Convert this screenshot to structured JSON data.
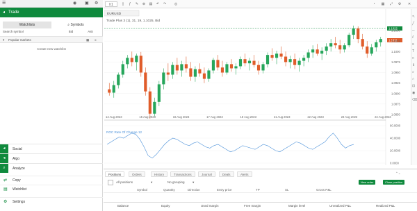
{
  "colors": {
    "brand": "#0f8a3d",
    "bull": "#26a65b",
    "bear": "#e05c2a",
    "indicator": "#4a90d9",
    "level": "#0f8a3d"
  },
  "sidebar": {
    "trade_title": "Trade",
    "tabs": [
      "Watchlists",
      "Symbols"
    ],
    "search_row": {
      "placeholder": "Search symbol",
      "bid": "Bid",
      "ask": "Ask"
    },
    "watchlist": "Popular markets",
    "create": "Create new watchlist",
    "nav": [
      {
        "label": "Social",
        "icon": "users-icon"
      },
      {
        "label": "Algo",
        "icon": "algo-icon"
      },
      {
        "label": "Analyze",
        "icon": "analyze-icon"
      }
    ],
    "nav2": [
      {
        "label": "Copy",
        "icon": "copy-icon"
      },
      {
        "label": "Watchlist",
        "icon": "list-icon"
      },
      {
        "label": "Settings",
        "icon": "gear-icon"
      }
    ]
  },
  "toolbar": {
    "timeframe": "h1",
    "symbol": "EURUSD"
  },
  "chart": {
    "legend": "Trade Plus 3 (1), 31, 19, 1.1025, Bid",
    "price_ticks": [
      "1.1050",
      "1.1025",
      "1.1000",
      "1.0975",
      "1.0950",
      "1.0925",
      "1.0900",
      "1.0875",
      "1.0850"
    ],
    "level_label": "1.1022",
    "price_tag": "1.1011",
    "dates": [
      "14 Aug 2023",
      "15 Aug 2023",
      "16 Aug 2023",
      "17 Aug 2023",
      "18 Aug 2023",
      "21 Aug 2023",
      "22 Aug 2023",
      "23 Aug 2023",
      "24 Aug 2023"
    ],
    "indicator_label": "ROC Rate Of Change 12",
    "indicator_ticks": [
      "60.0000",
      "40.0000",
      "20.0000",
      "0.0000"
    ]
  },
  "bottom": {
    "tabs": [
      "Positions",
      "Orders",
      "History",
      "Transactions",
      "Journal",
      "Deals",
      "Alerts"
    ],
    "account_label": "All positions",
    "group_label": "No grouping",
    "buttons": [
      "New order",
      "Close position"
    ],
    "columns": [
      "Symbol",
      "Quantity",
      "Direction",
      "Entry price",
      "TP",
      "SL",
      "Gross P&L"
    ],
    "footer": [
      "Balance",
      "Equity",
      "Used margin",
      "Free margin",
      "Margin level",
      "Unrealized P&L",
      "Realized P&L"
    ]
  },
  "chart_data": {
    "type": "candlestick",
    "series": [
      {
        "o": 1.091,
        "h": 1.0925,
        "l": 1.0895,
        "c": 1.0902
      },
      {
        "o": 1.0902,
        "h": 1.093,
        "l": 1.089,
        "c": 1.092
      },
      {
        "o": 1.092,
        "h": 1.095,
        "l": 1.0912,
        "c": 1.0945
      },
      {
        "o": 1.0945,
        "h": 1.0978,
        "l": 1.0938,
        "c": 1.097
      },
      {
        "o": 1.097,
        "h": 1.0992,
        "l": 1.096,
        "c": 1.0985
      },
      {
        "o": 1.0985,
        "h": 1.1,
        "l": 1.0965,
        "c": 1.0975
      },
      {
        "o": 1.0975,
        "h": 1.0995,
        "l": 1.0955,
        "c": 1.099
      },
      {
        "o": 1.099,
        "h": 1.0999,
        "l": 1.094,
        "c": 1.095
      },
      {
        "o": 1.095,
        "h": 1.0962,
        "l": 1.0895,
        "c": 1.0905
      },
      {
        "o": 1.0905,
        "h": 1.0915,
        "l": 1.084,
        "c": 1.0852
      },
      {
        "o": 1.0852,
        "h": 1.089,
        "l": 1.0845,
        "c": 1.088
      },
      {
        "o": 1.088,
        "h": 1.093,
        "l": 1.087,
        "c": 1.0922
      },
      {
        "o": 1.0922,
        "h": 1.096,
        "l": 1.091,
        "c": 1.095
      },
      {
        "o": 1.095,
        "h": 1.0972,
        "l": 1.093,
        "c": 1.0945
      },
      {
        "o": 1.0945,
        "h": 1.0975,
        "l": 1.0935,
        "c": 1.0968
      },
      {
        "o": 1.0968,
        "h": 1.0985,
        "l": 1.0945,
        "c": 1.0955
      },
      {
        "o": 1.0955,
        "h": 1.0978,
        "l": 1.094,
        "c": 1.097
      },
      {
        "o": 1.097,
        "h": 1.0988,
        "l": 1.095,
        "c": 1.096
      },
      {
        "o": 1.096,
        "h": 1.0975,
        "l": 1.093,
        "c": 1.094
      },
      {
        "o": 1.094,
        "h": 1.0965,
        "l": 1.0928,
        "c": 1.0958
      },
      {
        "o": 1.0958,
        "h": 1.0972,
        "l": 1.094,
        "c": 1.0948
      },
      {
        "o": 1.0948,
        "h": 1.0962,
        "l": 1.0925,
        "c": 1.0935
      },
      {
        "o": 1.0935,
        "h": 1.096,
        "l": 1.0928,
        "c": 1.0955
      },
      {
        "o": 1.0955,
        "h": 1.0985,
        "l": 1.0948,
        "c": 1.098
      },
      {
        "o": 1.098,
        "h": 1.0992,
        "l": 1.0955,
        "c": 1.0962
      },
      {
        "o": 1.0962,
        "h": 1.0978,
        "l": 1.094,
        "c": 1.095
      },
      {
        "o": 1.095,
        "h": 1.0975,
        "l": 1.0945,
        "c": 1.097
      },
      {
        "o": 1.097,
        "h": 1.0982,
        "l": 1.0952,
        "c": 1.096
      },
      {
        "o": 1.096,
        "h": 1.0972,
        "l": 1.0945,
        "c": 1.0965
      },
      {
        "o": 1.0965,
        "h": 1.0988,
        "l": 1.0958,
        "c": 1.0982
      },
      {
        "o": 1.0982,
        "h": 1.0995,
        "l": 1.0965,
        "c": 1.0972
      },
      {
        "o": 1.0972,
        "h": 1.0985,
        "l": 1.0955,
        "c": 1.0978
      },
      {
        "o": 1.0978,
        "h": 1.0992,
        "l": 1.0962,
        "c": 1.0968
      },
      {
        "o": 1.0968,
        "h": 1.0978,
        "l": 1.0945,
        "c": 1.0955
      },
      {
        "o": 1.0955,
        "h": 1.0975,
        "l": 1.0948,
        "c": 1.097
      },
      {
        "o": 1.097,
        "h": 1.0998,
        "l": 1.0962,
        "c": 1.0992
      },
      {
        "o": 1.0992,
        "h": 1.1008,
        "l": 1.0978,
        "c": 1.0985
      },
      {
        "o": 1.0985,
        "h": 1.1002,
        "l": 1.097,
        "c": 1.0995
      },
      {
        "o": 1.0995,
        "h": 1.1012,
        "l": 1.0982,
        "c": 1.0988
      },
      {
        "o": 1.0988,
        "h": 1.1,
        "l": 1.0965,
        "c": 1.0975
      },
      {
        "o": 1.0975,
        "h": 1.099,
        "l": 1.096,
        "c": 1.0982
      },
      {
        "o": 1.0982,
        "h": 1.0995,
        "l": 1.0958,
        "c": 1.0968
      },
      {
        "o": 1.0968,
        "h": 1.0985,
        "l": 1.0952,
        "c": 1.0978
      },
      {
        "o": 1.0978,
        "h": 1.0992,
        "l": 1.0965,
        "c": 1.0985
      },
      {
        "o": 1.0985,
        "h": 1.1005,
        "l": 1.0975,
        "c": 1.0998
      },
      {
        "o": 1.0998,
        "h": 1.1015,
        "l": 1.0985,
        "c": 1.1005
      },
      {
        "o": 1.1005,
        "h": 1.1018,
        "l": 1.099,
        "c": 1.0995
      },
      {
        "o": 1.0995,
        "h": 1.101,
        "l": 1.098,
        "c": 1.1002
      },
      {
        "o": 1.1002,
        "h": 1.102,
        "l": 1.0992,
        "c": 1.1012
      },
      {
        "o": 1.1012,
        "h": 1.103,
        "l": 1.1,
        "c": 1.102
      },
      {
        "o": 1.102,
        "h": 1.1035,
        "l": 1.1008,
        "c": 1.1015
      },
      {
        "o": 1.1015,
        "h": 1.1028,
        "l": 1.0995,
        "c": 1.1005
      },
      {
        "o": 1.1005,
        "h": 1.102,
        "l": 1.0998,
        "c": 1.1015
      },
      {
        "o": 1.1015,
        "h": 1.1045,
        "l": 1.101,
        "c": 1.104
      },
      {
        "o": 1.104,
        "h": 1.1062,
        "l": 1.103,
        "c": 1.1055
      },
      {
        "o": 1.1055,
        "h": 1.106,
        "l": 1.102,
        "c": 1.103
      },
      {
        "o": 1.103,
        "h": 1.1042,
        "l": 1.1005,
        "c": 1.1012
      },
      {
        "o": 1.1012,
        "h": 1.1025,
        "l": 1.0985,
        "c": 1.0995
      },
      {
        "o": 1.0995,
        "h": 1.1018,
        "l": 1.099,
        "c": 1.101
      },
      {
        "o": 1.101,
        "h": 1.1028,
        "l": 1.1,
        "c": 1.1022
      },
      {
        "o": 1.1022,
        "h": 1.1035,
        "l": 1.1012,
        "c": 1.103
      }
    ],
    "indicator": [
      30,
      34,
      38,
      42,
      40,
      44,
      48,
      46,
      38,
      26,
      12,
      8,
      14,
      22,
      30,
      36,
      40,
      38,
      34,
      30,
      28,
      32,
      34,
      30,
      26,
      24,
      28,
      30,
      26,
      22,
      18,
      20,
      24,
      28,
      26,
      24,
      22,
      26,
      30,
      28,
      24,
      20,
      18,
      22,
      26,
      30,
      34,
      32,
      28,
      24,
      22,
      26,
      30,
      34,
      42,
      48,
      40,
      30,
      24,
      28,
      30
    ],
    "ylim": [
      1.084,
      1.1065
    ],
    "indicator_ylim": [
      0,
      60
    ]
  }
}
